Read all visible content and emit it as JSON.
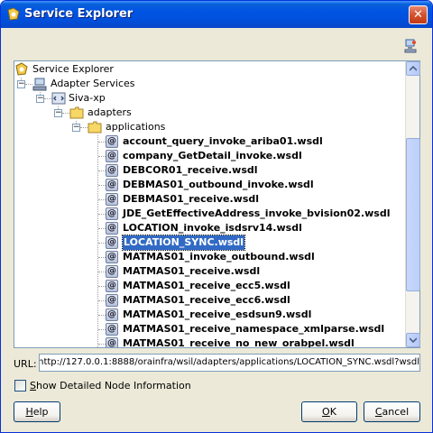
{
  "window": {
    "title": "Service Explorer",
    "close_glyph": "✕"
  },
  "toolbar": {
    "refresh_icon": "refresh-network-icon"
  },
  "tree": {
    "root": "Service Explorer",
    "adapter_services": "Adapter Services",
    "host": "Siva-xp",
    "adapters": "adapters",
    "applications": "applications",
    "wsdl_glyph": "@",
    "files": [
      "account_query_invoke_ariba01.wsdl",
      "company_GetDetail_invoke.wsdl",
      "DEBCOR01_receive.wsdl",
      "DEBMAS01_outbound_invoke.wsdl",
      "DEBMAS01_receive.wsdl",
      "JDE_GetEffectiveAddress_invoke_bvision02.wsdl",
      "LOCATION_invoke_isdsrv14.wsdl",
      "LOCATION_SYNC.wsdl",
      "MATMAS01_invoke_outbound.wsdl",
      "MATMAS01_receive.wsdl",
      "MATMAS01_receive_ecc5.wsdl",
      "MATMAS01_receive_ecc6.wsdl",
      "MATMAS01_receive_esdsun9.wsdl",
      "MATMAS01_receive_namespace_xmlparse.wsdl",
      "MATMAS01_receive_no_new_orabpel.wsdl"
    ],
    "selected": "LOCATION_SYNC.wsdl"
  },
  "url": {
    "label": "URL:",
    "value": "http://127.0.0.1:8888/orainfra/wsil/adapters/applications/LOCATION_SYNC.wsdl?wsdl"
  },
  "options": {
    "show_detail_label_mnemonic": "S",
    "show_detail_label_rest": "how Detailed Node Information",
    "show_detail_checked": false
  },
  "buttons": {
    "help_mnemonic": "H",
    "help_rest": "elp",
    "ok_mnemonic": "O",
    "ok_rest": "K",
    "cancel_mnemonic": "C",
    "cancel_rest": "ancel"
  }
}
